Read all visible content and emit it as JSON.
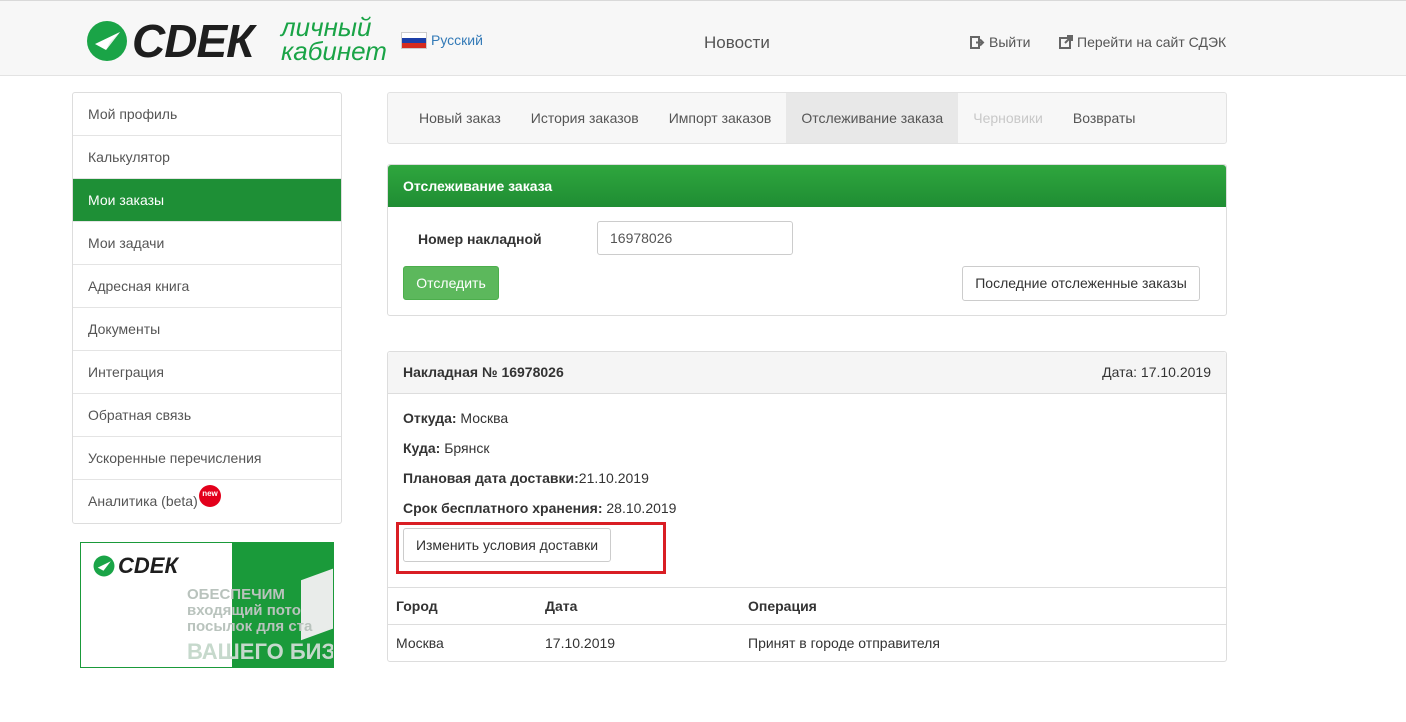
{
  "header": {
    "brand": "СDЕК",
    "brand_sub_line1": "личный",
    "brand_sub_line2": "кабинет",
    "language": "Русский",
    "news": "Новости",
    "logout": "Выйти",
    "go_to_site": "Перейти на сайт СДЭК",
    "colors": {
      "brand_green": "#1aa447",
      "active_green": "#1e8f36"
    }
  },
  "sidebar": {
    "items": [
      {
        "label": "Мой профиль"
      },
      {
        "label": "Калькулятор"
      },
      {
        "label": "Мои заказы",
        "active": true
      },
      {
        "label": "Мои задачи"
      },
      {
        "label": "Адресная книга"
      },
      {
        "label": "Документы"
      },
      {
        "label": "Интеграция"
      },
      {
        "label": "Обратная связь"
      },
      {
        "label": "Ускоренные перечисления"
      },
      {
        "label": "Аналитика (beta)",
        "badge": "new"
      }
    ]
  },
  "banner": {
    "brand": "СDЕК",
    "line1": "ОБЕСПЕЧИМ",
    "line2": "входящий пото",
    "line3": "посылок для ста",
    "line4": "ВАШЕГО БИЗ"
  },
  "tabs": [
    {
      "label": "Новый заказ"
    },
    {
      "label": "История заказов"
    },
    {
      "label": "Импорт заказов"
    },
    {
      "label": "Отслеживание заказа",
      "active": true
    },
    {
      "label": "Черновики",
      "disabled": true
    },
    {
      "label": "Возвраты"
    }
  ],
  "tracking": {
    "title": "Отслеживание заказа",
    "invoice_label": "Номер накладной",
    "invoice_value": "16978026",
    "track_button": "Отследить",
    "recent_button": "Последние отслеженные заказы"
  },
  "invoice": {
    "title": "Накладная № 16978026",
    "date": "Дата: 17.10.2019",
    "from_label": "Откуда:",
    "from_value": "Москва",
    "to_label": "Куда:",
    "to_value": "Брянск",
    "planned_label": "Плановая дата доставки:",
    "planned_value": "21.10.2019",
    "storage_label": "Срок бесплатного хранения:",
    "storage_value": "28.10.2019",
    "change_button": "Изменить условия доставки",
    "table": {
      "headers": [
        "Город",
        "Дата",
        "Операция"
      ],
      "rows": [
        [
          "Москва",
          "17.10.2019",
          "Принят в городе отправителя"
        ]
      ]
    }
  }
}
